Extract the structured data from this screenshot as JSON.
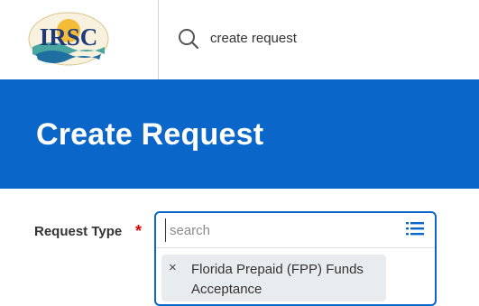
{
  "header": {
    "logo_text": "IRSC",
    "search_query": "create request"
  },
  "page": {
    "title": "Create Request"
  },
  "form": {
    "request_type": {
      "label": "Request Type",
      "required_marker": "*",
      "placeholder": "search",
      "selected": [
        {
          "remove_glyph": "×",
          "label": "Florida Prepaid (FPP) Funds Acceptance"
        }
      ]
    }
  },
  "colors": {
    "banner": "#0a66c9",
    "focus_border": "#0a66c9",
    "required": "#dd0000",
    "logo_navy": "#1f3a7a",
    "logo_gold": "#f2b21b",
    "logo_teal": "#4aa6a0"
  },
  "icons": {
    "search": "search-icon",
    "prompt_list": "list-icon",
    "remove": "close-icon"
  }
}
